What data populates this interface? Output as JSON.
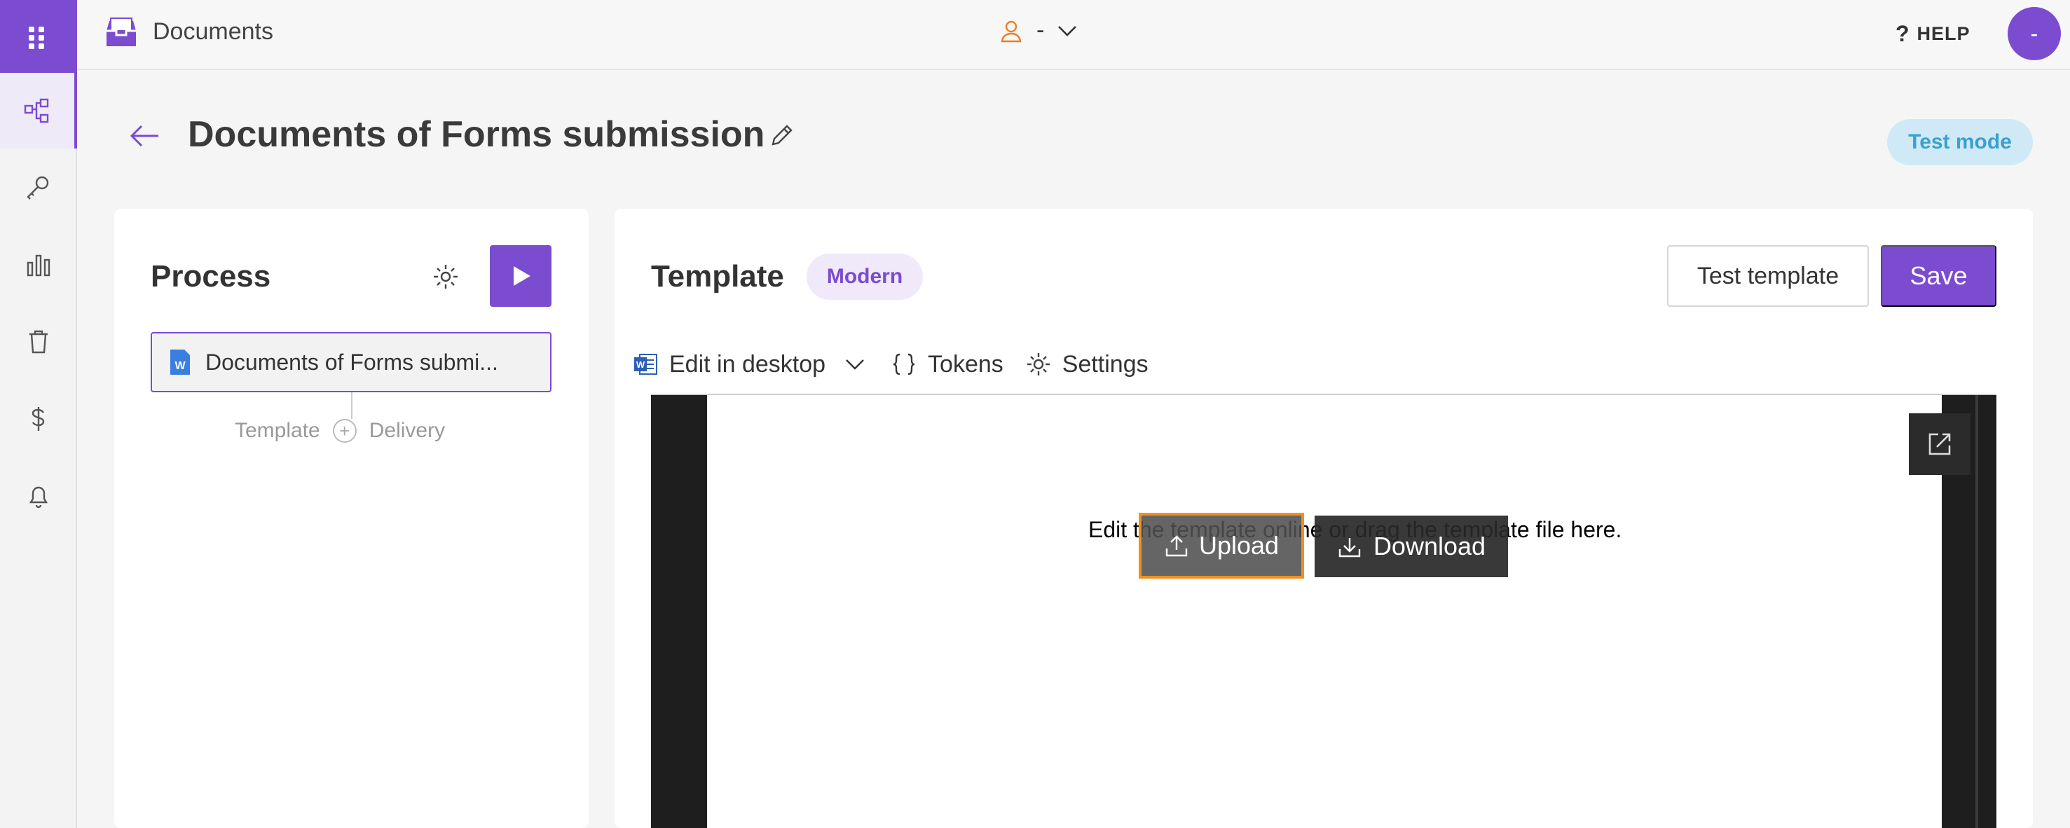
{
  "app": {
    "title": "Documents"
  },
  "user": {
    "name": "-"
  },
  "header": {
    "help_label": "HELP",
    "avatar_initial": "-"
  },
  "page": {
    "title": "Documents of Forms submission",
    "mode_badge": "Test mode"
  },
  "process": {
    "title": "Process",
    "document_item": "Documents of Forms submi...",
    "flow": {
      "left": "Template",
      "right": "Delivery"
    }
  },
  "template": {
    "title": "Template",
    "style_badge": "Modern",
    "test_button": "Test template",
    "save_button": "Save",
    "toolbar": {
      "edit_desktop": "Edit in desktop",
      "tokens": "Tokens",
      "settings": "Settings"
    },
    "editor": {
      "hint": "Edit the template online or drag the template file here.",
      "upload": "Upload",
      "download": "Download"
    }
  },
  "colors": {
    "accent": "#7b4bd0",
    "test_mode_bg": "#cfe9f6",
    "test_mode_text": "#3aa0cd",
    "upload_border": "#f0901e"
  }
}
